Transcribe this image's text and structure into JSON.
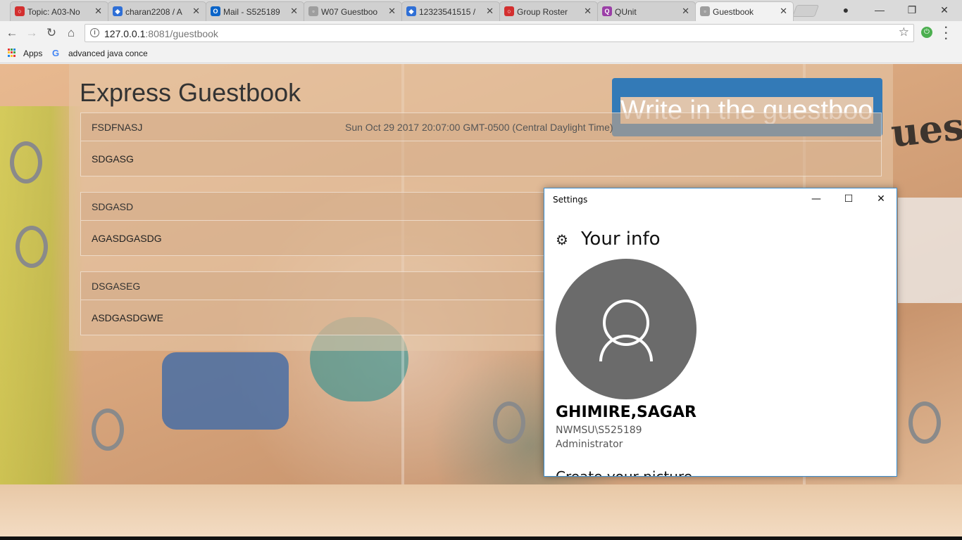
{
  "browser": {
    "tabs": [
      {
        "label": "Topic: A03-No",
        "fav_color": "#d32f2f",
        "fav_text": "○"
      },
      {
        "label": "charan2208 / A",
        "fav_color": "#2f6fd6",
        "fav_text": "◆"
      },
      {
        "label": "Mail - S525189",
        "fav_color": "#0a64c8",
        "fav_text": "O"
      },
      {
        "label": "W07 Guestboo",
        "fav_color": "#9e9e9e",
        "fav_text": "▫"
      },
      {
        "label": "12323541515 /",
        "fav_color": "#2f6fd6",
        "fav_text": "◆"
      },
      {
        "label": "Group Roster",
        "fav_color": "#d32f2f",
        "fav_text": "○"
      },
      {
        "label": "QUnit",
        "fav_color": "#9b3fa7",
        "fav_text": "Q"
      },
      {
        "label": "Guestbook",
        "fav_color": "#9e9e9e",
        "fav_text": "▫"
      }
    ],
    "active_tab_index": 7,
    "address": {
      "host": "127.0.0.1",
      "path": ":8081/guestbook"
    },
    "bookmarks": {
      "apps_label": "Apps",
      "item_label": "advanced java conce"
    }
  },
  "page": {
    "title": "Express Guestbook",
    "write_button_label": "Write in the guestbook",
    "entries": [
      {
        "name": "FSDFNASJ",
        "date": "Sun Oct 29 2017 20:07:00 GMT-0500 (Central Daylight Time)",
        "message": "SDGASG"
      },
      {
        "name": "SDGASD",
        "date": "",
        "message": "AGASDGASDG"
      },
      {
        "name": "DSGASEG",
        "date": "",
        "message": "ASDGASDGWE"
      }
    ]
  },
  "settings_window": {
    "title": "Settings",
    "heading": "Your info",
    "user_name": "GHIMIRE,SAGAR",
    "user_domain": "NWMSU\\S525189",
    "user_role": "Administrator",
    "next_section_partial": "Create your picture"
  }
}
